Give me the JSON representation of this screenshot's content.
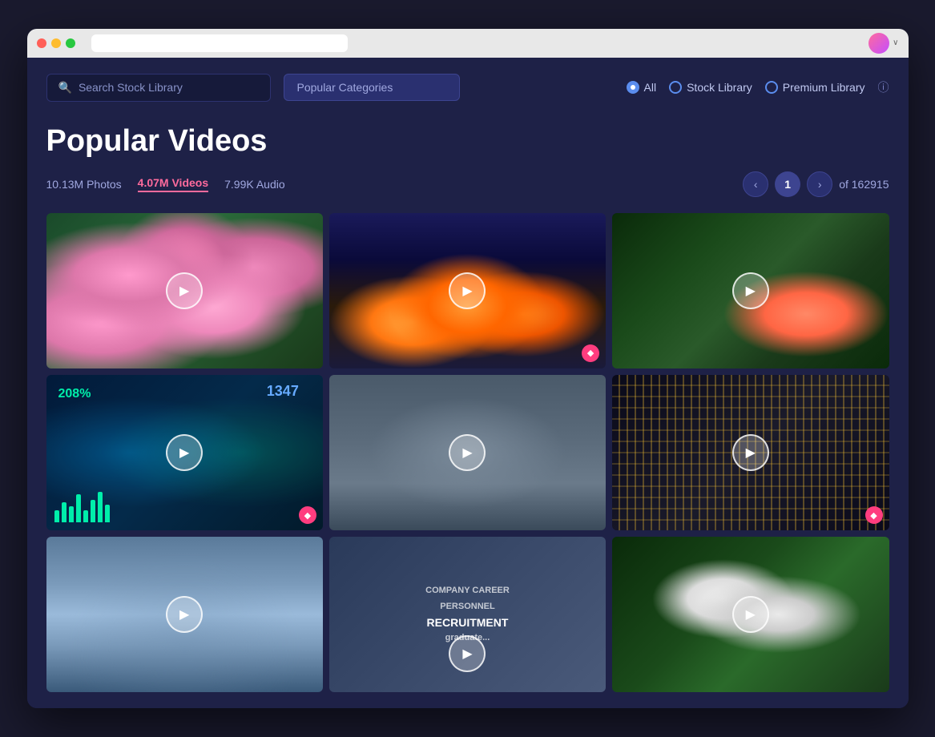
{
  "browser": {
    "traffic_lights": [
      "red",
      "yellow",
      "green"
    ]
  },
  "header": {
    "search_placeholder": "Search Stock Library",
    "categories_label": "Popular Categories",
    "filter_all": "All",
    "filter_stock": "Stock Library",
    "filter_premium": "Premium Library"
  },
  "page": {
    "title": "Popular Videos",
    "stats": {
      "photos": "10.13M Photos",
      "videos": "4.07M Videos",
      "audio": "7.99K Audio"
    },
    "pagination": {
      "current": "1",
      "total": "of 162915"
    }
  },
  "videos": [
    {
      "id": 1,
      "type": "flowers",
      "premium": false
    },
    {
      "id": 2,
      "type": "city",
      "premium": true
    },
    {
      "id": 3,
      "type": "nature",
      "premium": false
    },
    {
      "id": 4,
      "type": "data",
      "premium": true
    },
    {
      "id": 5,
      "type": "ocean",
      "premium": false
    },
    {
      "id": 6,
      "type": "building",
      "premium": true
    },
    {
      "id": 7,
      "type": "mountain",
      "premium": false
    },
    {
      "id": 8,
      "type": "recruitment",
      "premium": false
    },
    {
      "id": 9,
      "type": "white-flowers",
      "premium": false
    }
  ],
  "icons": {
    "search": "🔍",
    "play": "▶",
    "chevron_left": "‹",
    "chevron_right": "›",
    "diamond": "◆",
    "info": "ⓘ",
    "chevron_down": "∨"
  }
}
